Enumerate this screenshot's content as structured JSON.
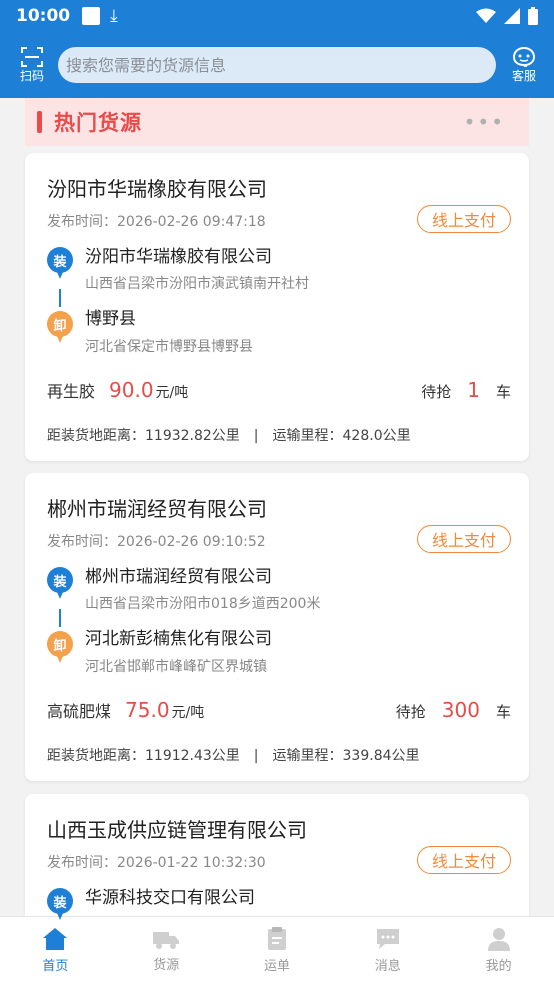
{
  "status": {
    "time": "10:00"
  },
  "topbar": {
    "scan_label": "扫码",
    "search_placeholder": "搜索您需要的货源信息",
    "service_label": "客服"
  },
  "section": {
    "title": "热门货源",
    "more": "•••"
  },
  "cards": [
    {
      "company": "汾阳市华瑞橡胶有限公司",
      "publish_time": "发布时间：2026-02-26 09:47:18",
      "payment": "线上支付",
      "load_tag": "装",
      "load_name": "汾阳市华瑞橡胶有限公司",
      "load_addr": "山西省吕梁市汾阳市演武镇南开社村",
      "unload_tag": "卸",
      "unload_name": "博野县",
      "unload_addr": "河北省保定市博野县博野县",
      "goods": "再生胶",
      "price": "90.0",
      "price_unit": "元/吨",
      "wait_label": "待抢",
      "wait_count": "1",
      "wait_unit": "车",
      "distance": "距装货地距离：11932.82公里　|　运输里程：428.0公里"
    },
    {
      "company": "郴州市瑞润经贸有限公司",
      "publish_time": "发布时间：2026-02-26 09:10:52",
      "payment": "线上支付",
      "load_tag": "装",
      "load_name": "郴州市瑞润经贸有限公司",
      "load_addr": "山西省吕梁市汾阳市018乡道西200米",
      "unload_tag": "卸",
      "unload_name": "河北新彭楠焦化有限公司",
      "unload_addr": "河北省邯郸市峰峰矿区界城镇",
      "goods": "高硫肥煤",
      "price": "75.0",
      "price_unit": "元/吨",
      "wait_label": "待抢",
      "wait_count": "300",
      "wait_unit": "车",
      "distance": "距装货地距离：11912.43公里　|　运输里程：339.84公里"
    },
    {
      "company": "山西玉成供应链管理有限公司",
      "publish_time": "发布时间：2026-01-22 10:32:30",
      "payment": "线上支付",
      "load_tag": "装",
      "load_name": "华源科技交口有限公司"
    }
  ],
  "tabs": [
    {
      "label": "首页",
      "icon": "home-icon"
    },
    {
      "label": "货源",
      "icon": "truck-icon"
    },
    {
      "label": "运单",
      "icon": "waybill-icon"
    },
    {
      "label": "消息",
      "icon": "message-icon"
    },
    {
      "label": "我的",
      "icon": "user-icon"
    }
  ],
  "colors": {
    "primary": "#1e7fd6",
    "accent_red": "#e94b4b",
    "accent_orange": "#f08a3c"
  }
}
